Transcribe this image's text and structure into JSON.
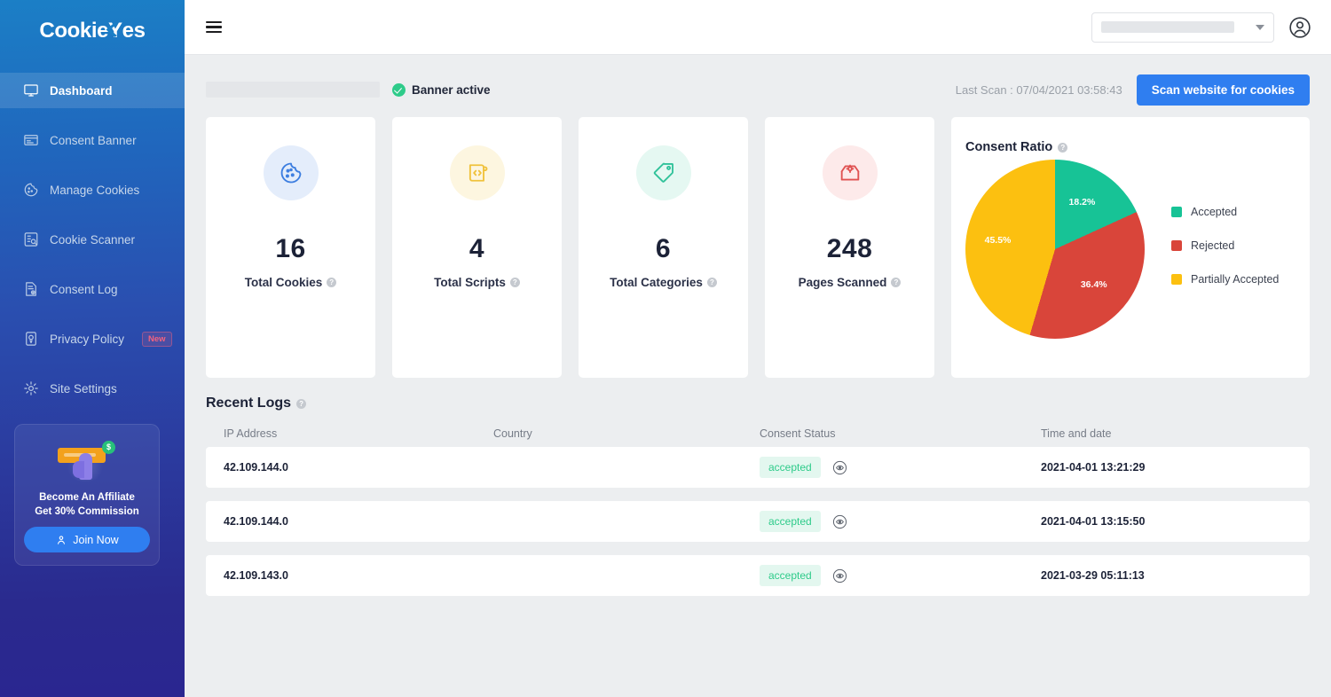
{
  "sidebar": {
    "brand": "CookieYes",
    "items": [
      {
        "label": "Dashboard",
        "icon": "monitor-icon",
        "active": true
      },
      {
        "label": "Consent Banner",
        "icon": "banner-icon",
        "active": false
      },
      {
        "label": "Manage Cookies",
        "icon": "cookie-icon",
        "active": false
      },
      {
        "label": "Cookie Scanner",
        "icon": "scanner-icon",
        "active": false
      },
      {
        "label": "Consent Log",
        "icon": "log-icon",
        "active": false
      },
      {
        "label": "Privacy Policy",
        "icon": "policy-icon",
        "active": false,
        "badge": "New"
      },
      {
        "label": "Site Settings",
        "icon": "gear-icon",
        "active": false
      }
    ],
    "promo": {
      "line1": "Become An Affiliate",
      "line2": "Get 30% Commission",
      "button": "Join Now",
      "coin": "$"
    }
  },
  "topbar": {
    "menu_icon": "hamburger-icon",
    "site_select_value": "",
    "account_icon": "user-account-icon"
  },
  "status": {
    "site_name": "",
    "banner_state": "Banner active",
    "last_scan": "Last Scan : 07/04/2021 03:58:43",
    "scan_button": "Scan website for cookies"
  },
  "stats": [
    {
      "value": "16",
      "label": "Total Cookies",
      "icon": "cookie-icon",
      "color": "#3d7ee0",
      "bg": "#e4edfb"
    },
    {
      "value": "4",
      "label": "Total Scripts",
      "icon": "script-icon",
      "color": "#f0c23c",
      "bg": "#fdf6e0"
    },
    {
      "value": "6",
      "label": "Total Categories",
      "icon": "tag-icon",
      "color": "#30c29a",
      "bg": "#e5f8f2"
    },
    {
      "value": "248",
      "label": "Pages Scanned",
      "icon": "pagescan-icon",
      "color": "#e05252",
      "bg": "#fdeaea"
    }
  ],
  "chart_data": {
    "type": "pie",
    "title": "Consent Ratio",
    "categories": [
      "Accepted",
      "Rejected",
      "Partially Accepted"
    ],
    "values": [
      18.2,
      36.4,
      45.5
    ],
    "labels": [
      "18.2%",
      "36.4%",
      "45.5%"
    ],
    "colors": [
      "#17c396",
      "#d9453a",
      "#fcc010"
    ],
    "legend_position": "right",
    "unit": "percent"
  },
  "logs": {
    "title": "Recent Logs",
    "columns": [
      "IP Address",
      "Country",
      "Consent Status",
      "Time and date"
    ],
    "rows": [
      {
        "ip": "42.109.144.0",
        "country": "",
        "status": "accepted",
        "datetime": "2021-04-01 13:21:29"
      },
      {
        "ip": "42.109.144.0",
        "country": "",
        "status": "accepted",
        "datetime": "2021-04-01 13:15:50"
      },
      {
        "ip": "42.109.143.0",
        "country": "",
        "status": "accepted",
        "datetime": "2021-03-29 05:11:13"
      }
    ]
  },
  "glyphs": {
    "question": "?"
  }
}
